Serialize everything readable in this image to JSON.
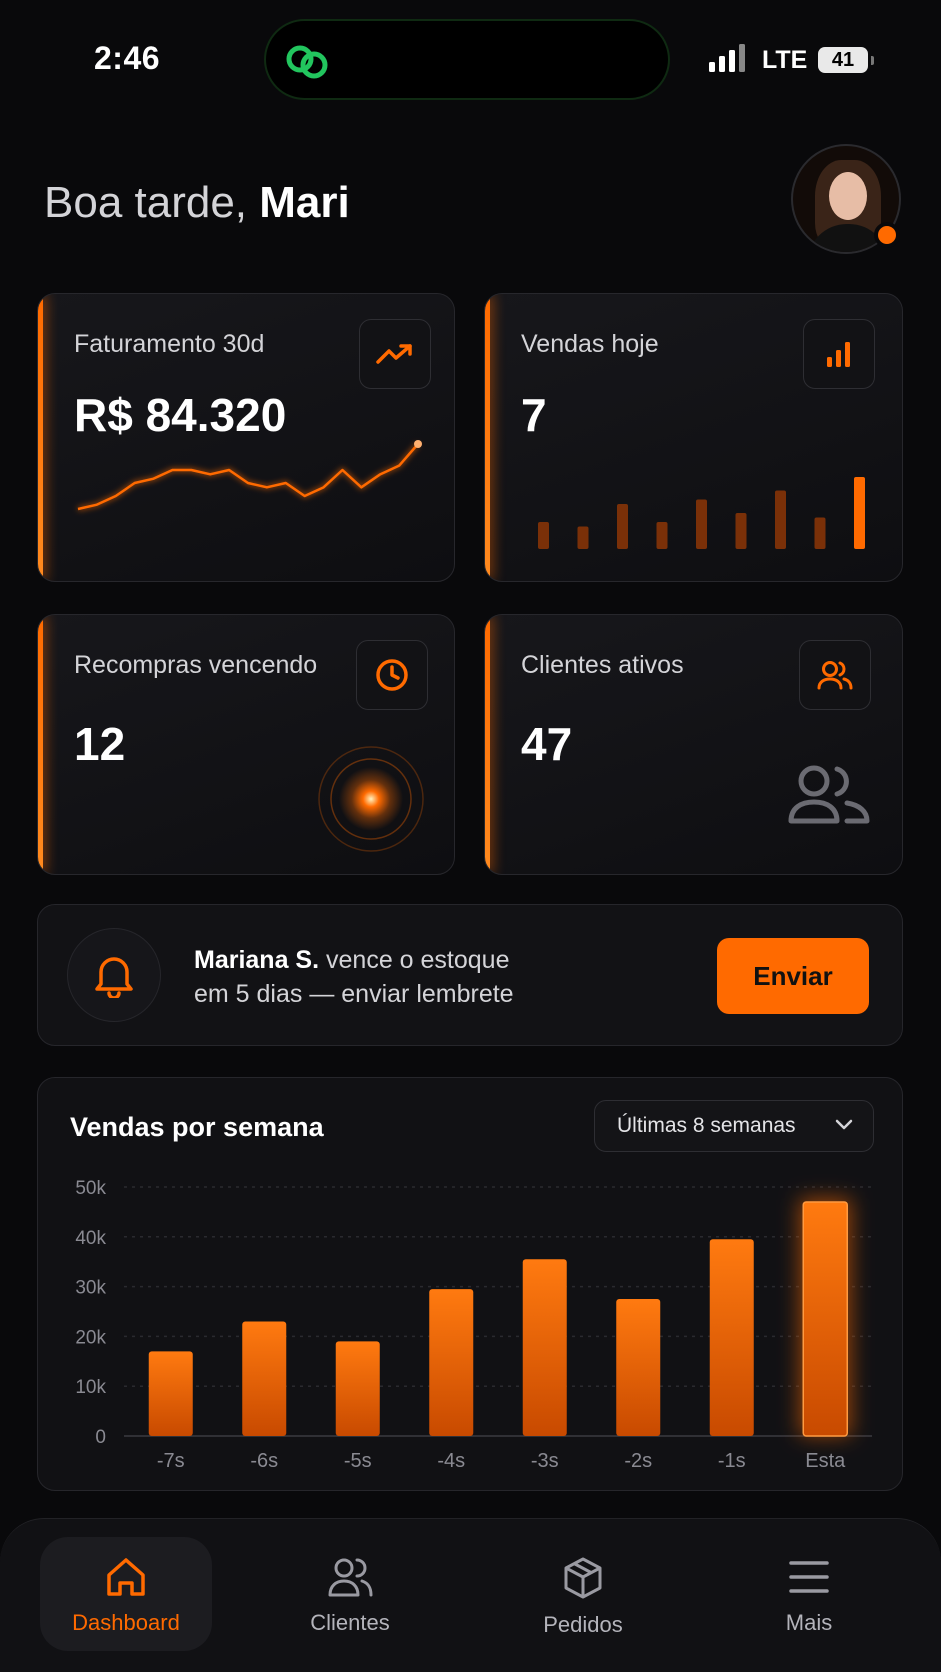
{
  "status_bar": {
    "time": "2:46",
    "network": "LTE",
    "battery": "41"
  },
  "header": {
    "greeting": "Boa tarde,",
    "name": "Mari"
  },
  "cards": {
    "revenue": {
      "label": "Faturamento 30d",
      "value": "R$ 84.320",
      "icon": "trending-up-icon",
      "sparkline": [
        3,
        4,
        6,
        9,
        10,
        12,
        12,
        11,
        12,
        9,
        8,
        9,
        6,
        8,
        12,
        8,
        11,
        13,
        18
      ]
    },
    "sales_today": {
      "label": "Vendas hoje",
      "value": "7",
      "icon": "bar-chart-icon",
      "bars": [
        3,
        2.5,
        5,
        3,
        5.5,
        4,
        6.5,
        3.5,
        8
      ]
    },
    "repurchases": {
      "label": "Recompras vencendo",
      "value": "12",
      "icon": "clock-icon"
    },
    "active_clients": {
      "label": "Clientes ativos",
      "value": "47",
      "icon": "users-icon"
    }
  },
  "alert": {
    "name": "Mariana S.",
    "message_part1": " vence o estoque",
    "message_part2": "em 5 dias — enviar lembrete",
    "button": "Enviar"
  },
  "weekly": {
    "title": "Vendas por semana",
    "range_select": "Últimas 8 semanas"
  },
  "chart_data": {
    "type": "bar",
    "title": "Vendas por semana",
    "categories": [
      "-7s",
      "-6s",
      "-5s",
      "-4s",
      "-3s",
      "-2s",
      "-1s",
      "Esta"
    ],
    "values": [
      17000,
      23000,
      19000,
      29500,
      35500,
      27500,
      39500,
      47000
    ],
    "ylim": [
      0,
      50000
    ],
    "yticks": [
      "0",
      "10k",
      "20k",
      "30k",
      "40k",
      "50k"
    ],
    "grid": true,
    "colors": {
      "bar": "#ff6a00"
    }
  },
  "nav": {
    "items": [
      {
        "label": "Dashboard",
        "icon": "home-icon",
        "active": true
      },
      {
        "label": "Clientes",
        "icon": "users-icon"
      },
      {
        "label": "Pedidos",
        "icon": "box-icon"
      },
      {
        "label": "Mais",
        "icon": "menu-icon"
      }
    ]
  },
  "colors": {
    "accent": "#ff6a00",
    "background": "#09090b"
  }
}
